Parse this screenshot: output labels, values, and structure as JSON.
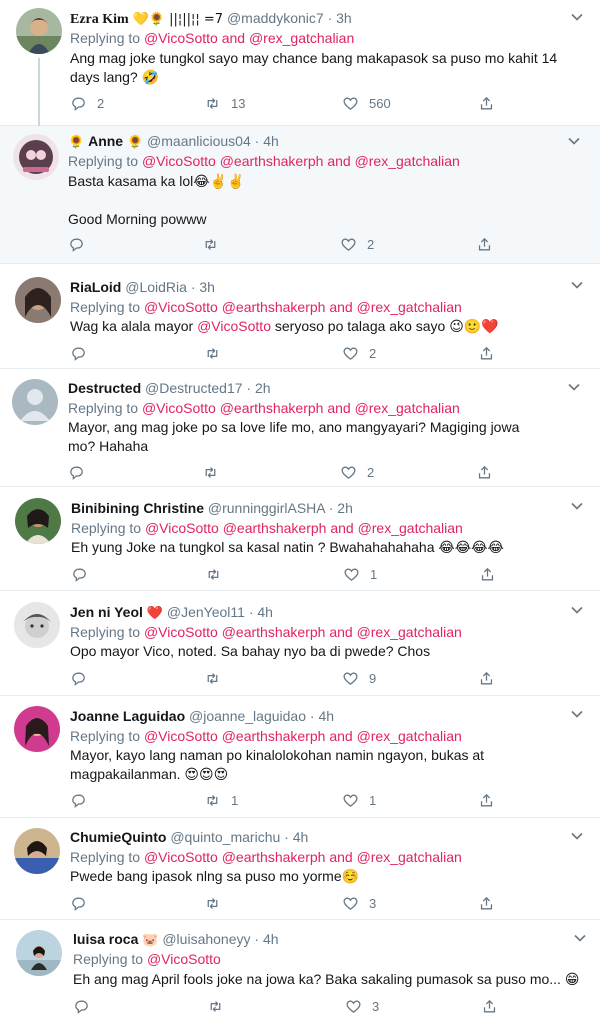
{
  "tweets": [
    {
      "name": "Ezra Kim",
      "name_emoji": "💛🌻 ||¦||¦¦ =7",
      "handle": "@maddykonic7",
      "time": "3h",
      "replying_prefix": "Replying to",
      "replying_mentions": "@VicoSotto and @rex_gatchalian",
      "text": "Ang mag joke tungkol sayo may chance bang makapasok sa puso mo kahit 14 days lang? 🤣",
      "replies": "2",
      "retweets": "13",
      "likes": "560"
    },
    {
      "name_prefix_emoji": "🌻",
      "name": "Anne",
      "name_emoji": "🌻",
      "handle": "@maanlicious04",
      "time": "4h",
      "replying_prefix": "Replying to",
      "replying_mentions": "@VicoSotto @earthshakerph and @rex_gatchalian",
      "text": "Basta kasama ka lol😂✌️✌️\n\nGood Morning powww",
      "replies": "",
      "retweets": "",
      "likes": "2"
    },
    {
      "name": "RiaLoid",
      "handle": "@LoidRia",
      "time": "3h",
      "replying_prefix": "Replying to",
      "replying_mentions": "@VicoSotto @earthshakerph and @rex_gatchalian",
      "text_pre": "Wag ka alala mayor ",
      "text_mention": "@VicoSotto",
      "text_post": " seryoso po talaga ako sayo 😉🙂❤️",
      "replies": "",
      "retweets": "",
      "likes": "2"
    },
    {
      "name": "Destructed",
      "handle": "@Destructed17",
      "time": "2h",
      "replying_prefix": "Replying to",
      "replying_mentions": "@VicoSotto @earthshakerph and @rex_gatchalian",
      "text": "Mayor, ang mag joke po sa love life mo, ano mangyayari? Magiging jowa mo? Hahaha",
      "replies": "",
      "retweets": "",
      "likes": "2"
    },
    {
      "name": "Binibining Christine",
      "handle": "@runninggirlASHA",
      "time": "2h",
      "replying_prefix": "Replying to",
      "replying_mentions": "@VicoSotto @earthshakerph and @rex_gatchalian",
      "text": "Eh yung Joke na tungkol sa kasal natin ? Bwahahahahaha 😂😂😂😂",
      "replies": "",
      "retweets": "",
      "likes": "1"
    },
    {
      "name": "Jen ni Yeol",
      "name_emoji": "❤️",
      "handle": "@JenYeol11",
      "time": "4h",
      "replying_prefix": "Replying to",
      "replying_mentions": "@VicoSotto @earthshakerph and @rex_gatchalian",
      "text": "Opo mayor Vico, noted. Sa bahay nyo ba di pwede? Chos",
      "replies": "",
      "retweets": "",
      "likes": "9"
    },
    {
      "name": "Joanne Laguidao",
      "handle": "@joanne_laguidao",
      "time": "4h",
      "replying_prefix": "Replying to",
      "replying_mentions": "@VicoSotto @earthshakerph and @rex_gatchalian",
      "text": "Mayor, kayo lang naman po kinalolokohan namin ngayon, bukas at magpakailanman. 😍😍😍",
      "replies": "",
      "retweets": "1",
      "likes": "1"
    },
    {
      "name": "ChumieQuinto",
      "handle": "@quinto_marichu",
      "time": "4h",
      "replying_prefix": "Replying to",
      "replying_mentions": "@VicoSotto @earthshakerph and @rex_gatchalian",
      "text": "Pwede bang ipasok nlng sa puso mo yorme☺️",
      "replies": "",
      "retweets": "",
      "likes": "3"
    },
    {
      "name": "luisa roca",
      "name_emoji": "🐷",
      "handle": "@luisahoneyy",
      "time": "4h",
      "replying_prefix": "Replying to",
      "replying_mentions": "@VicoSotto",
      "text": "Eh ang mag April fools joke na jowa ka? Baka sakaling pumasok sa puso mo... 😁",
      "replies": "",
      "retweets": "",
      "likes": "3"
    }
  ],
  "dot": "·",
  "colors": {
    "mention": "#e0245e",
    "muted": "#657786",
    "text": "#14171a",
    "highlight_bg": "#f5f8fa"
  }
}
